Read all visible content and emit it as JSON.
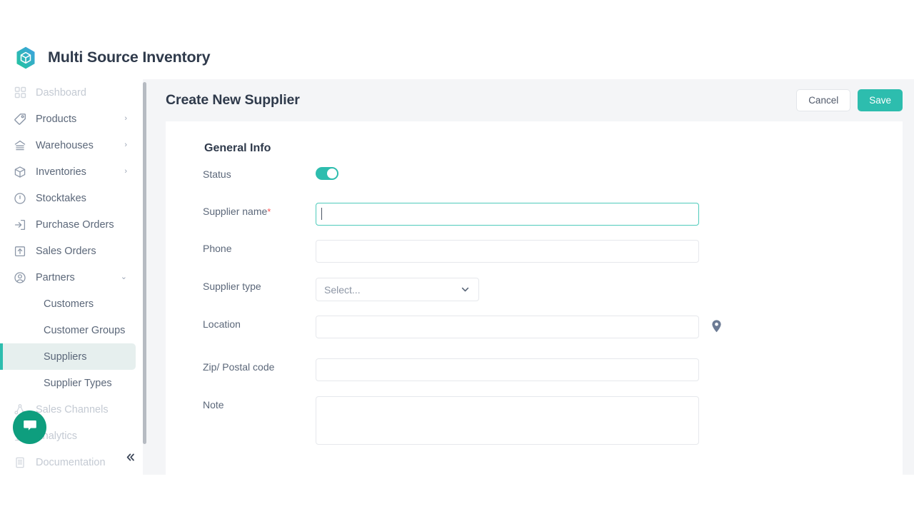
{
  "brand": {
    "title": "Multi Source Inventory",
    "logo_icon": "cube-hexagon-logo",
    "colors": {
      "logo_from": "#2dd4a8",
      "logo_to": "#3a9fe0"
    }
  },
  "sidebar": {
    "items": [
      {
        "label": "Dashboard",
        "icon": "grid-icon",
        "state": "dim",
        "caret": ""
      },
      {
        "label": "Products",
        "icon": "tag-icon",
        "state": "normal",
        "caret": "›"
      },
      {
        "label": "Warehouses",
        "icon": "warehouse-icon",
        "state": "normal",
        "caret": "›"
      },
      {
        "label": "Inventories",
        "icon": "box-icon",
        "state": "normal",
        "caret": "›"
      },
      {
        "label": "Stocktakes",
        "icon": "clock-count-icon",
        "state": "normal",
        "caret": ""
      },
      {
        "label": "Purchase Orders",
        "icon": "arrow-into-box-icon",
        "state": "normal",
        "caret": ""
      },
      {
        "label": "Sales Orders",
        "icon": "arrow-out-box-icon",
        "state": "normal",
        "caret": ""
      },
      {
        "label": "Partners",
        "icon": "user-circle-icon",
        "state": "normal",
        "caret": "⌄"
      }
    ],
    "sub_items": [
      {
        "label": "Customers",
        "active": false
      },
      {
        "label": "Customer Groups",
        "active": false
      },
      {
        "label": "Suppliers",
        "active": true
      },
      {
        "label": "Supplier Types",
        "active": false
      }
    ],
    "footer_items": [
      {
        "label": "Sales Channels",
        "icon": "share-nodes-icon",
        "state": "dim",
        "caret": ""
      },
      {
        "label": "Analytics",
        "icon": "chart-icon",
        "state": "dim",
        "caret": ""
      },
      {
        "label": "Documentation",
        "icon": "book-icon",
        "state": "dim",
        "caret": ""
      }
    ],
    "collapse_icon": "chevron-double-left-icon",
    "active_accent": "#2dbdae",
    "active_background": "#e6efee"
  },
  "chat_widget": {
    "icon": "chat-bubble-icon",
    "color": "#0e9e7e"
  },
  "header": {
    "title": "Create New Supplier",
    "cancel_label": "Cancel",
    "save_label": "Save",
    "save_color": "#2dbdae"
  },
  "form": {
    "section_title": "General Info",
    "fields": {
      "status": {
        "label": "Status",
        "value_on": true
      },
      "supplier_name": {
        "label": "Supplier name",
        "required_mark": "*",
        "value": "",
        "placeholder": "",
        "focused": true
      },
      "phone": {
        "label": "Phone",
        "value": "",
        "placeholder": ""
      },
      "supplier_type": {
        "label": "Supplier type",
        "selected": "Select...",
        "chevron_icon": "chevron-down-icon"
      },
      "location": {
        "label": "Location",
        "value": "",
        "placeholder": "",
        "pin_icon": "map-pin-icon"
      },
      "zip": {
        "label": "Zip/ Postal code",
        "value": "",
        "placeholder": ""
      },
      "note": {
        "label": "Note",
        "value": "",
        "placeholder": ""
      }
    }
  }
}
